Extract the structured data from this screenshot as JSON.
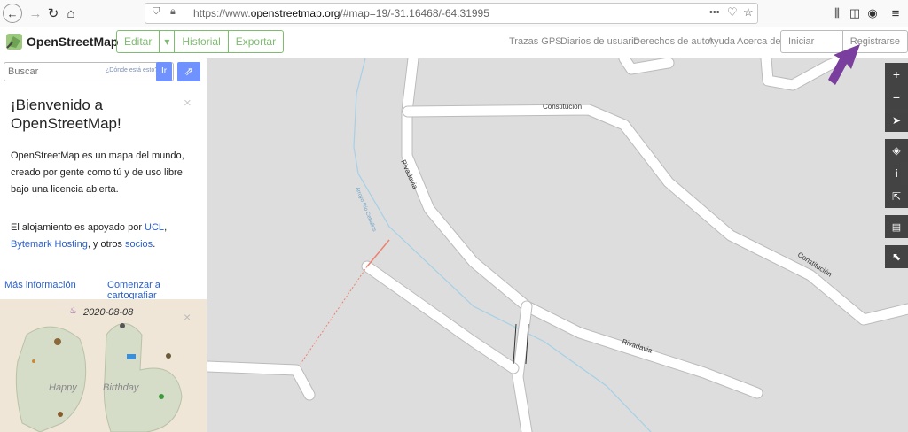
{
  "browser": {
    "url_prefix": "https://www.",
    "url_domain": "openstreetmap.org",
    "url_rest": "/#map=19/-31.16468/-64.31995",
    "more_label": "•••"
  },
  "header": {
    "brand": "OpenStreetMap",
    "edit_label": "Editar",
    "edit_dropdown": "▾",
    "history_label": "Historial",
    "export_label": "Exportar",
    "links": [
      "Trazas GPS",
      "Diarios de usuario",
      "Derechos de autor",
      "Ayuda",
      "Acerca de"
    ],
    "login_label": "Iniciar sesión",
    "signup_label": "Registrarse"
  },
  "sidebar": {
    "search_placeholder": "Buscar",
    "where_label": "¿Dónde está esto?",
    "go_label": "Ir",
    "welcome_title": "¡Bienvenido a OpenStreetMap!",
    "intro": "OpenStreetMap es un mapa del mundo, creado por gente como tú y de uso libre bajo una licencia abierta.",
    "hosting_prefix": "El alojamiento es apoyado por ",
    "ucl": "UCL",
    "bytemark": "Bytemark Hosting",
    "hosting_middle": ", y otros ",
    "partners": "socios",
    "hosting_end": ".",
    "more_info": "Más información",
    "start_mapping": "Comenzar a cartografiar",
    "close_symbol": "×",
    "bday_date": "2020-08-08",
    "bday_happy": "Happy",
    "bday_birthday": "Birthday"
  },
  "map": {
    "streets": [
      "Constitución",
      "Rivadavia",
      "Constitución",
      "Rivadavia"
    ],
    "stream": "Arroyo Río Ceballos"
  },
  "colors": {
    "osm_green": "#7ebc6f",
    "link_blue": "#2860d0",
    "button_blue": "#7092ff",
    "map_bg": "#dddddd",
    "stream_blue": "#a5d0e6",
    "arrow_purple": "#7a3f9e"
  }
}
